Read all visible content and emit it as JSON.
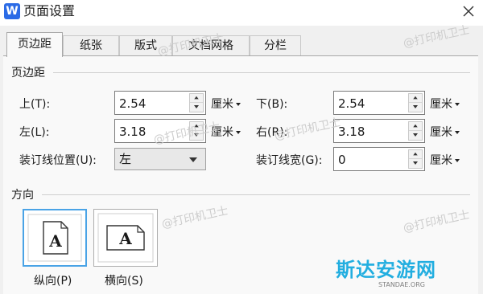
{
  "window": {
    "app_icon_letter": "W",
    "title": "页面设置",
    "close_icon": "close-icon"
  },
  "tabs": [
    {
      "label": "页边距",
      "active": true
    },
    {
      "label": "纸张",
      "active": false
    },
    {
      "label": "版式",
      "active": false
    },
    {
      "label": "文档网格",
      "active": false
    },
    {
      "label": "分栏",
      "active": false
    }
  ],
  "margins": {
    "group_label": "页边距",
    "top": {
      "label": "上(T):",
      "value": "2.54",
      "unit": "厘米"
    },
    "bottom": {
      "label": "下(B):",
      "value": "2.54",
      "unit": "厘米"
    },
    "left": {
      "label": "左(L):",
      "value": "3.18",
      "unit": "厘米"
    },
    "right": {
      "label": "右(R):",
      "value": "3.18",
      "unit": "厘米"
    },
    "gutter_position": {
      "label": "装订线位置(U):",
      "value": "左"
    },
    "gutter_width": {
      "label": "装订线宽(G):",
      "value": "0",
      "unit": "厘米"
    }
  },
  "orientation": {
    "group_label": "方向",
    "portrait": {
      "label": "纵向(P)",
      "glyph": "A",
      "selected": true
    },
    "landscape": {
      "label": "横向(S)",
      "glyph": "A",
      "selected": false
    }
  },
  "watermark_text": "@打印机卫士",
  "logo": {
    "main": "斯达安游网",
    "sub": "STANDAE.ORG"
  },
  "colors": {
    "accent": "#4aa3e6",
    "logo": "#22aee0",
    "app_icon": "#2b6be6"
  }
}
